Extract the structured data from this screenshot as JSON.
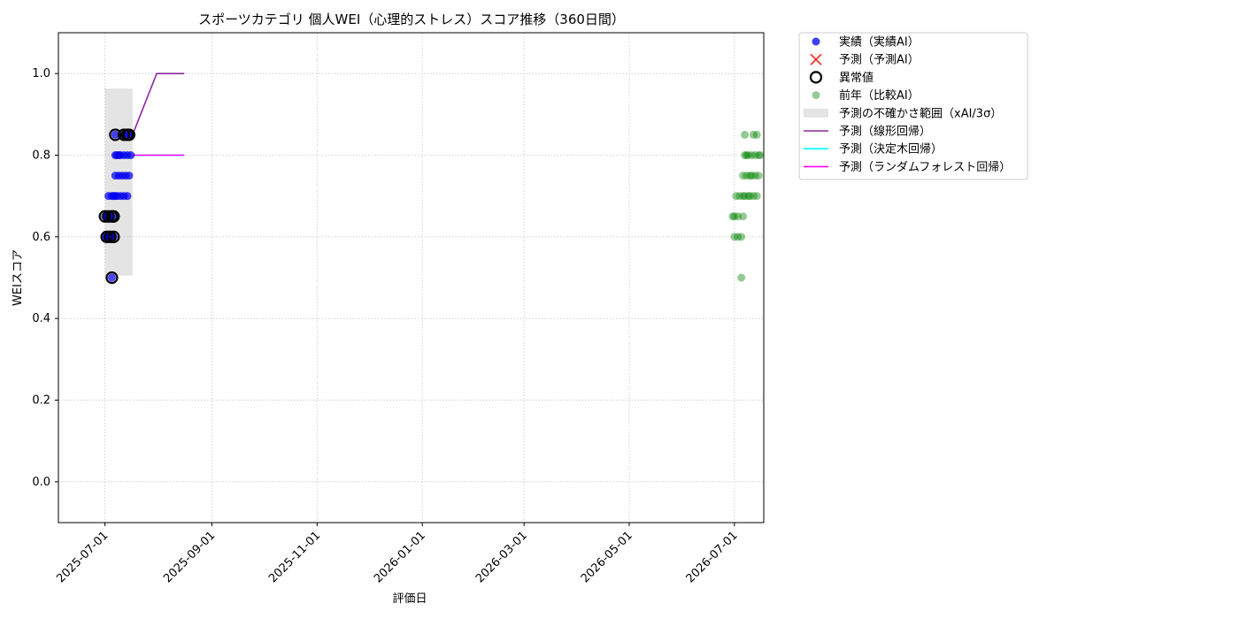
{
  "chart_data": {
    "type": "scatter",
    "title": "スポーツカテゴリ 個人WEI（心理的ストレス）スコア推移（360日間）",
    "xlabel": "評価日",
    "ylabel": "WEIスコア",
    "xlim": [
      "2025-06-04",
      "2026-07-18"
    ],
    "ylim": [
      -0.1,
      1.1
    ],
    "grid": true,
    "legend_position": "outside-right-top",
    "xticks": [
      "2025-07-01",
      "2025-09-01",
      "2025-11-01",
      "2026-01-01",
      "2026-03-01",
      "2026-05-01",
      "2026-07-01"
    ],
    "yticks": [
      0.0,
      0.2,
      0.4,
      0.6,
      0.8,
      1.0
    ],
    "ytick_labels": [
      "0.0",
      "0.2",
      "0.4",
      "0.6",
      "0.8",
      "1.0"
    ],
    "legend": [
      {
        "label": "実績（実績AI）",
        "marker": "dot",
        "color": "#0000ee"
      },
      {
        "label": "予測（予測AI）",
        "marker": "x",
        "color": "#ff3333"
      },
      {
        "label": "異常値",
        "marker": "ring",
        "color": "#000000"
      },
      {
        "label": "前年（比較AI）",
        "marker": "dot-faded",
        "color": "#008000"
      },
      {
        "label": "予測の不確かさ範囲（xAI/3σ）",
        "marker": "band",
        "color": "#cccccc"
      },
      {
        "label": "予測（線形回帰）",
        "marker": "line",
        "color": "#8b2a9e"
      },
      {
        "label": "予測（決定木回帰）",
        "marker": "line",
        "color": "#00ffff"
      },
      {
        "label": "予測（ランダムフォレスト回帰）",
        "marker": "line",
        "color": "#ff00ff"
      }
    ],
    "uncertainty_band": {
      "x": [
        "2025-07-01",
        "2025-07-17"
      ],
      "y": [
        0.505,
        0.963
      ]
    },
    "series": [
      {
        "name": "実績（実績AI）",
        "kind": "scatter",
        "color": "#0000ee",
        "points": [
          [
            "2025-07-01",
            0.65
          ],
          [
            "2025-07-01",
            0.6
          ],
          [
            "2025-07-02",
            0.65
          ],
          [
            "2025-07-02",
            0.6
          ],
          [
            "2025-07-03",
            0.7
          ],
          [
            "2025-07-03",
            0.65
          ],
          [
            "2025-07-04",
            0.6
          ],
          [
            "2025-07-04",
            0.65
          ],
          [
            "2025-07-05",
            0.7
          ],
          [
            "2025-07-05",
            0.6
          ],
          [
            "2025-07-05",
            0.5
          ],
          [
            "2025-07-06",
            0.65
          ],
          [
            "2025-07-06",
            0.7
          ],
          [
            "2025-07-06",
            0.6
          ],
          [
            "2025-07-07",
            0.8
          ],
          [
            "2025-07-07",
            0.85
          ],
          [
            "2025-07-07",
            0.75
          ],
          [
            "2025-07-07",
            0.7
          ],
          [
            "2025-07-08",
            0.8
          ],
          [
            "2025-07-08",
            0.7
          ],
          [
            "2025-07-09",
            0.8
          ],
          [
            "2025-07-09",
            0.75
          ],
          [
            "2025-07-10",
            0.7
          ],
          [
            "2025-07-10",
            0.8
          ],
          [
            "2025-07-11",
            0.85
          ],
          [
            "2025-07-11",
            0.75
          ],
          [
            "2025-07-12",
            0.8
          ],
          [
            "2025-07-12",
            0.7
          ],
          [
            "2025-07-13",
            0.85
          ],
          [
            "2025-07-13",
            0.75
          ],
          [
            "2025-07-14",
            0.8
          ],
          [
            "2025-07-14",
            0.7
          ],
          [
            "2025-07-15",
            0.85
          ],
          [
            "2025-07-15",
            0.75
          ],
          [
            "2025-07-16",
            0.8
          ],
          [
            "2025-07-16",
            0.85
          ]
        ]
      },
      {
        "name": "異常値",
        "kind": "ring",
        "color": "#000000",
        "points": [
          [
            "2025-07-01",
            0.65
          ],
          [
            "2025-07-02",
            0.6
          ],
          [
            "2025-07-03",
            0.65
          ],
          [
            "2025-07-04",
            0.6
          ],
          [
            "2025-07-05",
            0.65
          ],
          [
            "2025-07-05",
            0.5
          ],
          [
            "2025-07-06",
            0.65
          ],
          [
            "2025-07-06",
            0.6
          ],
          [
            "2025-07-07",
            0.85
          ],
          [
            "2025-07-12",
            0.85
          ],
          [
            "2025-07-14",
            0.85
          ],
          [
            "2025-07-15",
            0.85
          ]
        ]
      },
      {
        "name": "前年（比較AI）",
        "kind": "scatter",
        "color": "#008000",
        "points": [
          [
            "2026-06-30",
            0.65
          ],
          [
            "2026-07-01",
            0.6
          ],
          [
            "2026-07-01",
            0.65
          ],
          [
            "2026-07-02",
            0.7
          ],
          [
            "2026-07-03",
            0.6
          ],
          [
            "2026-07-03",
            0.65
          ],
          [
            "2026-07-04",
            0.7
          ],
          [
            "2026-07-05",
            0.6
          ],
          [
            "2026-07-05",
            0.5
          ],
          [
            "2026-07-06",
            0.65
          ],
          [
            "2026-07-06",
            0.7
          ],
          [
            "2026-07-06",
            0.75
          ],
          [
            "2026-07-07",
            0.8
          ],
          [
            "2026-07-07",
            0.85
          ],
          [
            "2026-07-07",
            0.7
          ],
          [
            "2026-07-08",
            0.8
          ],
          [
            "2026-07-08",
            0.75
          ],
          [
            "2026-07-09",
            0.7
          ],
          [
            "2026-07-09",
            0.8
          ],
          [
            "2026-07-10",
            0.75
          ],
          [
            "2026-07-10",
            0.7
          ],
          [
            "2026-07-11",
            0.8
          ],
          [
            "2026-07-11",
            0.75
          ],
          [
            "2026-07-12",
            0.85
          ],
          [
            "2026-07-12",
            0.7
          ],
          [
            "2026-07-13",
            0.8
          ],
          [
            "2026-07-13",
            0.75
          ],
          [
            "2026-07-14",
            0.85
          ],
          [
            "2026-07-14",
            0.7
          ],
          [
            "2026-07-15",
            0.8
          ],
          [
            "2026-07-15",
            0.75
          ],
          [
            "2026-07-16",
            0.8
          ]
        ]
      },
      {
        "name": "予測（線形回帰）",
        "kind": "line",
        "color": "#8b2a9e",
        "points": [
          [
            "2025-07-17",
            0.85
          ],
          [
            "2025-07-31",
            1.0
          ],
          [
            "2025-08-16",
            1.0
          ]
        ]
      },
      {
        "name": "予測（決定木回帰）",
        "kind": "line",
        "color": "#00ffff",
        "points": [
          [
            "2025-07-17",
            0.8
          ],
          [
            "2025-08-16",
            0.8
          ]
        ]
      },
      {
        "name": "予測（ランダムフォレスト回帰）",
        "kind": "line",
        "color": "#ff00ff",
        "points": [
          [
            "2025-07-17",
            0.8
          ],
          [
            "2025-08-16",
            0.8
          ]
        ]
      }
    ]
  }
}
